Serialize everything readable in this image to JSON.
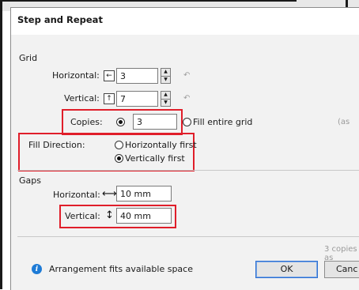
{
  "dialog": {
    "title": "Step and Repeat"
  },
  "grid": {
    "section_label": "Grid",
    "horizontal_label": "Horizontal:",
    "horizontal_value": "3",
    "vertical_label": "Vertical:",
    "vertical_value": "7",
    "copies_label": "Copies:",
    "copies_value": "3",
    "fill_entire_grid_label": "Fill entire grid",
    "truncated_hint": "(as",
    "fill_direction_label": "Fill Direction:",
    "horizontally_first_label": "Horizontally first",
    "vertically_first_label": "Vertically first",
    "copies_selected": true,
    "fill_entire_grid_selected": false,
    "horizontally_first_selected": false,
    "vertically_first_selected": true
  },
  "gaps": {
    "section_label": "Gaps",
    "horizontal_label": "Horizontal:",
    "horizontal_value": "10 mm",
    "vertical_label": "Vertical:",
    "vertical_value": "40 mm"
  },
  "footer": {
    "summary_text": "3 copies as",
    "info_text": "Arrangement fits available space",
    "ok_label": "OK",
    "cancel_label": "Canc"
  },
  "icons": {
    "horizontal_arrow": "arrow-left-icon",
    "vertical_arrow": "arrow-up-icon",
    "link": "link-icon",
    "horizontal_gap": "horizontal-gap-icon",
    "vertical_gap": "vertical-gap-icon",
    "info": "info-icon"
  },
  "colors": {
    "highlight": "#e01e2a",
    "dialog_bg": "#f2f2f2",
    "info_blue": "#1e7bd6"
  }
}
